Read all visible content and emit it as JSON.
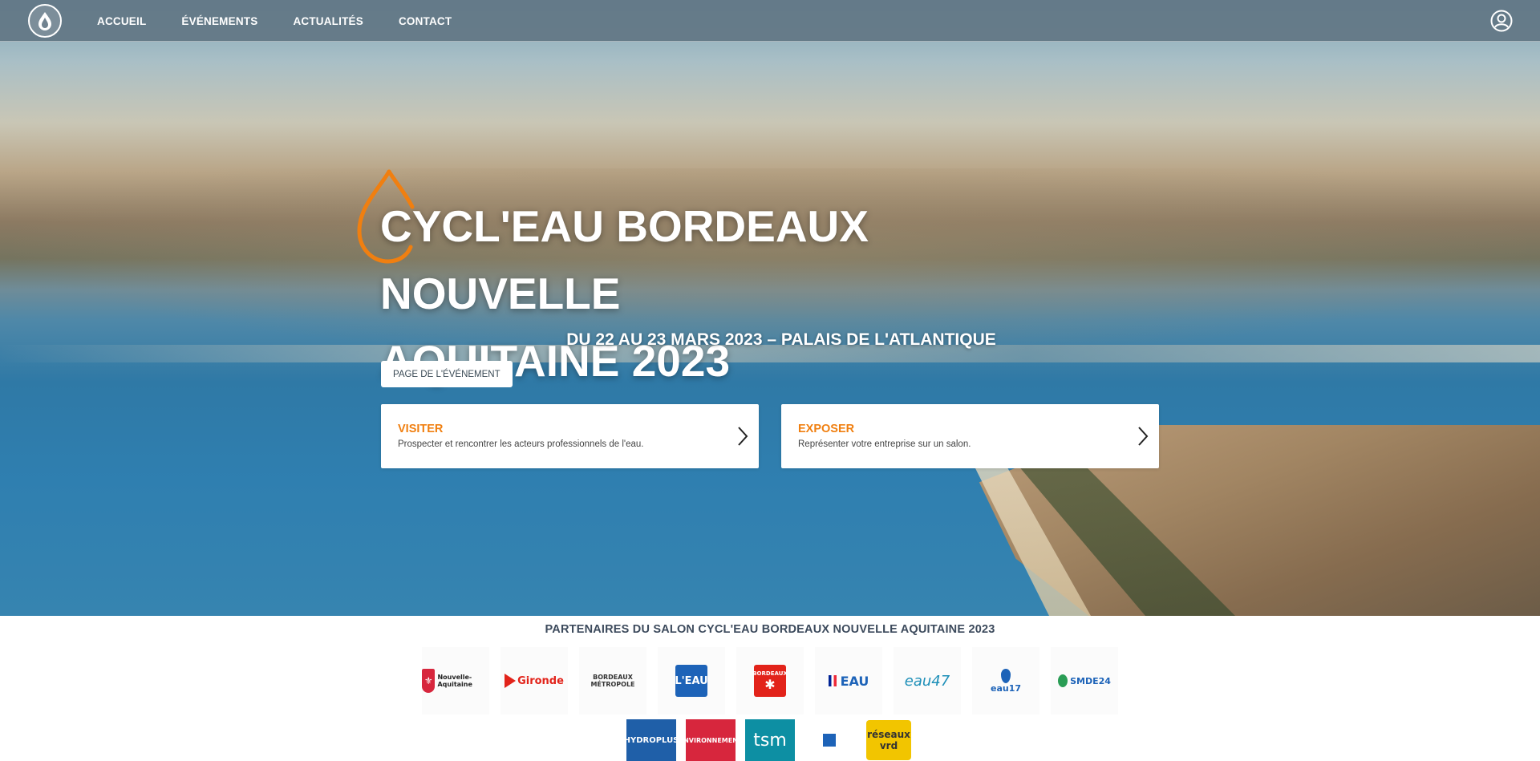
{
  "nav": {
    "links": [
      "ACCUEIL",
      "ÉVÉNEMENTS",
      "ACTUALITÉS",
      "CONTACT"
    ]
  },
  "hero": {
    "title_line1": "CYCL'EAU BORDEAUX NOUVELLE",
    "title_line2": "AQUITAINE 2023",
    "subtitle": "DU 22 AU 23 MARS 2023 – PALAIS DE L'ATLANTIQUE",
    "event_button": "PAGE DE L'ÉVÉNEMENT",
    "cards": [
      {
        "title": "VISITER",
        "desc": "Prospecter et rencontrer les acteurs professionnels de l'eau."
      },
      {
        "title": "EXPOSER",
        "desc": "Représenter votre entreprise sur un salon."
      }
    ]
  },
  "partners": {
    "title": "PARTENAIRES DU SALON CYCL'EAU BORDEAUX NOUVELLE AQUITAINE 2023",
    "row1": [
      {
        "name": "nouvelle-aquitaine-logo",
        "text": "Nouvelle-Aquitaine"
      },
      {
        "name": "gironde-logo",
        "text": "Gironde"
      },
      {
        "name": "bordeaux-metropole-logo",
        "text": "BORDEAUX MÉTROPOLE"
      },
      {
        "name": "leau-logo",
        "text": "L'EAU"
      },
      {
        "name": "bordeaux-logo",
        "text": "BORDEAUX"
      },
      {
        "name": "republique-francaise-eau-logo",
        "text": "EAU"
      },
      {
        "name": "eau47-logo",
        "text": "eau47"
      },
      {
        "name": "eau17-logo",
        "text": "eau17"
      },
      {
        "name": "smde24-logo",
        "text": "SMDE24"
      }
    ],
    "row2": [
      {
        "name": "hydroplus-logo",
        "text": "HYDROPLUS"
      },
      {
        "name": "environnement-magazine-logo",
        "text": "ENVIRONNEMENT"
      },
      {
        "name": "tsm-logo",
        "text": "tsm"
      },
      {
        "name": "eau-industrie-nuisances-logo",
        "text": ""
      },
      {
        "name": "reseaux-vrd-logo",
        "text": "réseaux vrd"
      }
    ]
  },
  "colors": {
    "accent_orange": "#f07f10",
    "nav_bg": "#62768a",
    "partners_title": "#3c4a5c"
  }
}
